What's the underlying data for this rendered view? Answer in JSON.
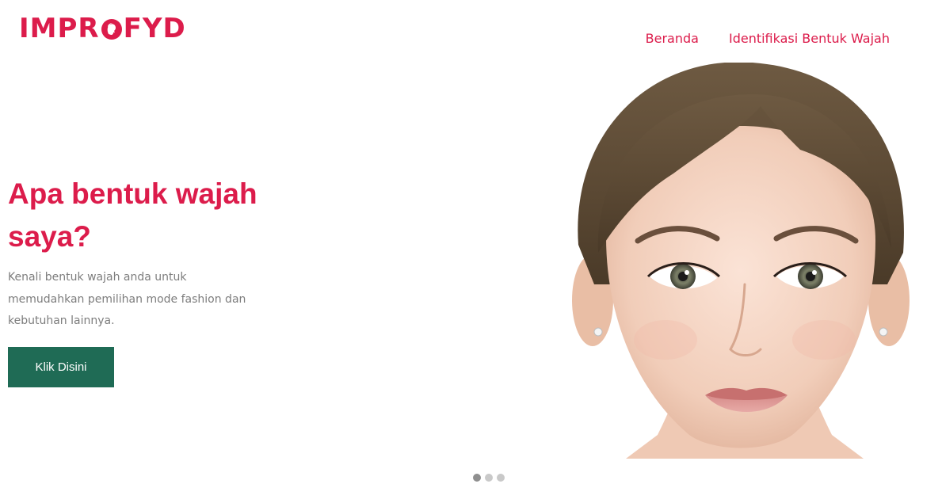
{
  "header": {
    "logo_prefix": "IMPR",
    "logo_suffix": "FYD",
    "nav": [
      {
        "label": "Beranda"
      },
      {
        "label": "Identifikasi Bentuk Wajah"
      }
    ]
  },
  "hero": {
    "title": "Apa bentuk wajah saya?",
    "description": "Kenali bentuk wajah anda untuk memudahkan pemilihan mode fashion dan kebutuhan lainnya.",
    "button_label": "Klik Disini"
  },
  "carousel": {
    "slide_count": 3,
    "active_index": 0
  },
  "colors": {
    "brand": "#dc1c4b",
    "button": "#1f6b55",
    "body_text": "#7d7d7d"
  }
}
